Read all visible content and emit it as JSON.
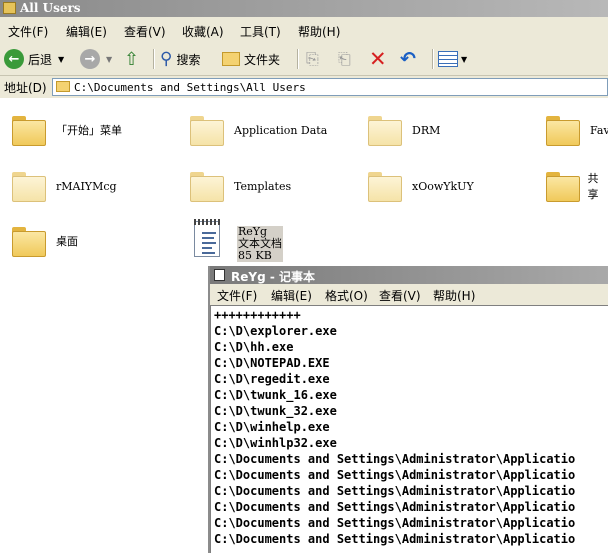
{
  "window": {
    "title": "All Users"
  },
  "menubar": {
    "items": [
      "文件(F)",
      "编辑(E)",
      "查看(V)",
      "收藏(A)",
      "工具(T)",
      "帮助(H)"
    ]
  },
  "toolbar": {
    "back_label": "后退",
    "search_label": "搜索",
    "folders_label": "文件夹"
  },
  "address": {
    "label": "地址(D)",
    "path": "C:\\Documents and Settings\\All Users"
  },
  "files": [
    {
      "name": "「开始」菜单"
    },
    {
      "name": "Application Data"
    },
    {
      "name": "DRM"
    },
    {
      "name": "Fav"
    },
    {
      "name": "rMAIYMcg"
    },
    {
      "name": "Templates"
    },
    {
      "name": "xOowYkUY"
    },
    {
      "name": "共享"
    },
    {
      "name": "桌面"
    }
  ],
  "selected_file": {
    "name": "ReYg",
    "type": "文本文档",
    "size": "85 KB"
  },
  "notepad": {
    "title": "ReYg - 记事本",
    "menu": [
      "文件(F)",
      "编辑(E)",
      "格式(O)",
      "查看(V)",
      "帮助(H)"
    ],
    "lines": [
      "++++++++++++",
      "C:\\D\\explorer.exe",
      "C:\\D\\hh.exe",
      "C:\\D\\NOTEPAD.EXE",
      "C:\\D\\regedit.exe",
      "C:\\D\\twunk_16.exe",
      "C:\\D\\twunk_32.exe",
      "C:\\D\\winhelp.exe",
      "C:\\D\\winhlp32.exe",
      "C:\\Documents and Settings\\Administrator\\Applicatio",
      "C:\\Documents and Settings\\Administrator\\Applicatio",
      "C:\\Documents and Settings\\Administrator\\Applicatio",
      "C:\\Documents and Settings\\Administrator\\Applicatio",
      "C:\\Documents and Settings\\Administrator\\Applicatio",
      "C:\\Documents and Settings\\Administrator\\Applicatio"
    ]
  }
}
